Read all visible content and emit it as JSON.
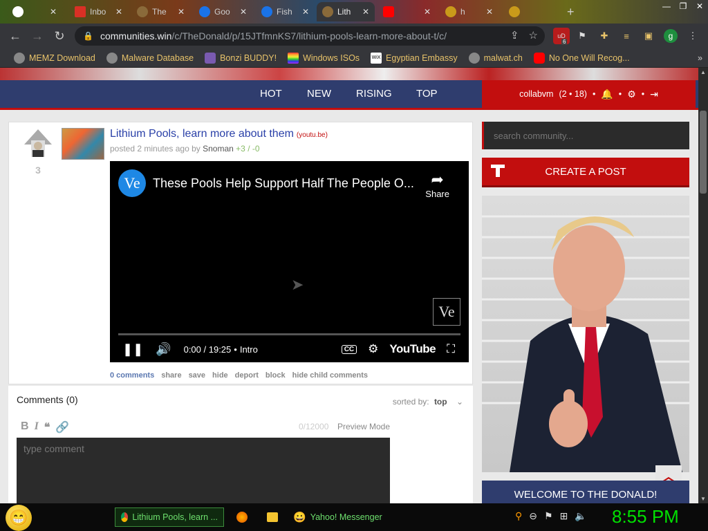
{
  "browser": {
    "tabs": [
      {
        "label": "",
        "color": "#ffffff"
      },
      {
        "label": "Inbo",
        "color": "#d93025"
      },
      {
        "label": "The",
        "color": "#8a6a3a"
      },
      {
        "label": "Goo",
        "color": "#1a73e8"
      },
      {
        "label": "Fish",
        "color": "#1a73e8"
      },
      {
        "label": "Lith",
        "color": "#8a6a3a"
      },
      {
        "label": "",
        "color": "#ff0000"
      },
      {
        "label": "h",
        "color": "#c99a1a"
      }
    ],
    "url_host": "communities.win",
    "url_path": "/c/TheDonald/p/15JTfmnKS7/lithium-pools-learn-more-about-t/c/",
    "ext_badge": "6",
    "profile_initial": "g"
  },
  "bookmarks": [
    {
      "label": "MEMZ Download",
      "icon": "globe-icon"
    },
    {
      "label": "Malware Database",
      "icon": "globe-icon"
    },
    {
      "label": "Bonzi BUDDY!",
      "icon": "bonzi-icon"
    },
    {
      "label": "Windows ISOs",
      "icon": "windows-flag-icon"
    },
    {
      "label": "Egyptian Embassy",
      "icon": "wix-icon"
    },
    {
      "label": "malwat.ch",
      "icon": "globe-icon"
    },
    {
      "label": "No One Will Recog...",
      "icon": "youtube-icon"
    }
  ],
  "site": {
    "nav": [
      "HOT",
      "NEW",
      "RISING",
      "TOP"
    ],
    "user": "collabvm",
    "user_stats": "(2 • 18)",
    "accent": "#c20e0e",
    "navy": "#2f3d6e"
  },
  "post": {
    "score": "3",
    "title": "Lithium Pools, learn more about them",
    "domain": "(youtu.be)",
    "posted": "posted 2 minutes ago by",
    "author": "Snoman",
    "upvotes": "+3",
    "sep": "/",
    "downvotes": "-0",
    "actions": [
      "0 comments",
      "share",
      "save",
      "hide",
      "deport",
      "block",
      "hide child comments"
    ]
  },
  "video": {
    "channel_logo": "Ve",
    "title": "These Pools Help Support Half The People O...",
    "share_label": "Share",
    "time": "0:00 / 19:25",
    "chapter": "Intro",
    "cc_label": "CC",
    "brand": "YouTube",
    "watermark": "Ve",
    "progress": 0
  },
  "comments": {
    "title": "Comments (0)",
    "sorted_label": "sorted by:",
    "sorted_value": "top",
    "charcount": "0/12000",
    "preview": "Preview Mode",
    "placeholder": "type comment"
  },
  "sidebar": {
    "search_placeholder": "search community...",
    "create_label": "CREATE A POST",
    "welcome_label": "WELCOME TO THE DONALD!"
  },
  "taskbar": {
    "items": [
      {
        "label": "Lithium Pools, learn ...",
        "active": true
      },
      {
        "label": "",
        "active": false
      },
      {
        "label": "",
        "active": false
      },
      {
        "label": "Yahoo! Messenger",
        "active": false
      }
    ],
    "clock": "8:55 PM"
  }
}
